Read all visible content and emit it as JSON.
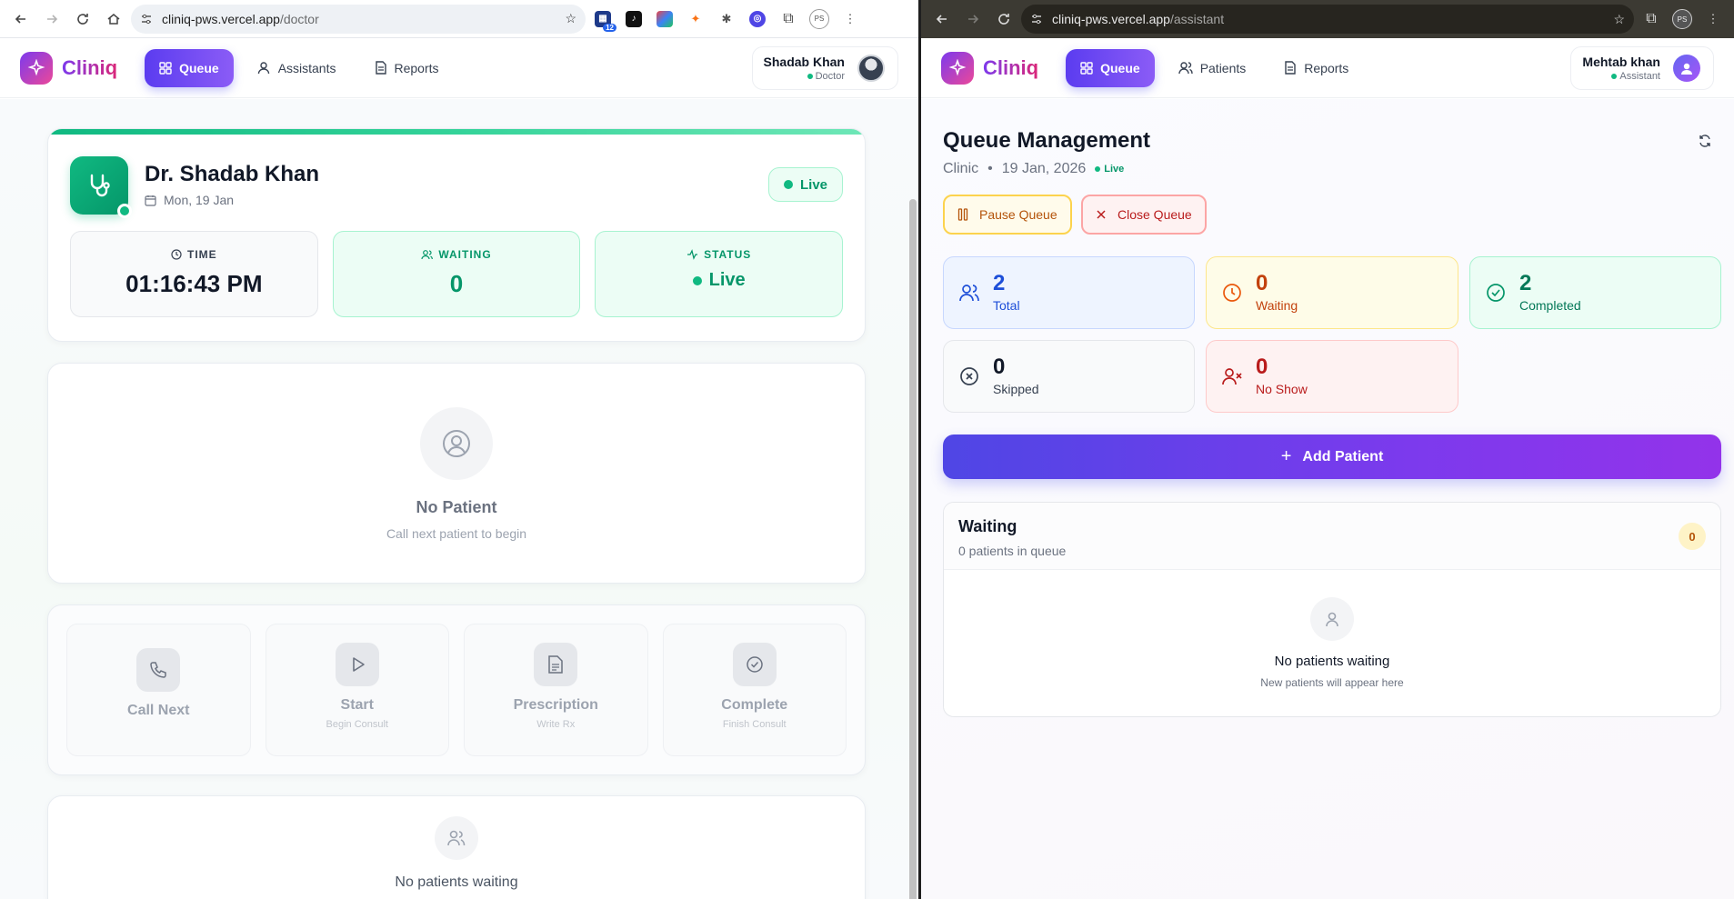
{
  "left": {
    "browser": {
      "url_host": "cliniq-pws.vercel.app",
      "url_path": "/doctor",
      "extension_badge": "12",
      "profile": "PS"
    },
    "app": {
      "logo": "Cliniq",
      "nav": [
        {
          "label": "Queue",
          "icon": "grid-icon"
        },
        {
          "label": "Assistants",
          "icon": "user-icon"
        },
        {
          "label": "Reports",
          "icon": "document-icon"
        }
      ],
      "user": {
        "name": "Shadab Khan",
        "role": "Doctor"
      }
    },
    "doctor": {
      "name": "Dr. Shadab Khan",
      "date": "Mon, 19 Jan",
      "live": "Live"
    },
    "stats": {
      "time_label": "TIME",
      "time_value": "01:16:43 PM",
      "waiting_label": "WAITING",
      "waiting_value": "0",
      "status_label": "STATUS",
      "status_value": "Live"
    },
    "no_patient": {
      "title": "No Patient",
      "subtitle": "Call next patient to begin"
    },
    "actions": [
      {
        "title": "Call Next",
        "subtitle": ""
      },
      {
        "title": "Start",
        "subtitle": "Begin Consult"
      },
      {
        "title": "Prescription",
        "subtitle": "Write Rx"
      },
      {
        "title": "Complete",
        "subtitle": "Finish Consult"
      }
    ],
    "waiting_list": {
      "title": "No patients waiting"
    }
  },
  "right": {
    "browser": {
      "url_host": "cliniq-pws.vercel.app",
      "url_path": "/assistant",
      "profile": "PS"
    },
    "app": {
      "logo": "Cliniq",
      "nav": [
        {
          "label": "Queue",
          "icon": "grid-icon"
        },
        {
          "label": "Patients",
          "icon": "users-icon"
        },
        {
          "label": "Reports",
          "icon": "document-icon"
        }
      ],
      "user": {
        "name": "Mehtab khan",
        "role": "Assistant"
      }
    },
    "queue": {
      "title": "Queue Management",
      "clinic": "Clinic",
      "date": "19 Jan, 2026",
      "live": "Live",
      "pause_label": "Pause Queue",
      "close_label": "Close Queue"
    },
    "stats": [
      {
        "value": "2",
        "label": "Total"
      },
      {
        "value": "0",
        "label": "Waiting"
      },
      {
        "value": "2",
        "label": "Completed"
      },
      {
        "value": "0",
        "label": "Skipped"
      },
      {
        "value": "0",
        "label": "No Show"
      }
    ],
    "add_patient": "Add Patient",
    "waiting": {
      "title": "Waiting",
      "subtitle": "0 patients in queue",
      "count": "0",
      "empty_title": "No patients waiting",
      "empty_subtitle": "New patients will appear here"
    }
  },
  "colors": {
    "brand_primary": "#5b3cf0",
    "brand_accent": "#db2777",
    "live_green": "#10b981"
  }
}
